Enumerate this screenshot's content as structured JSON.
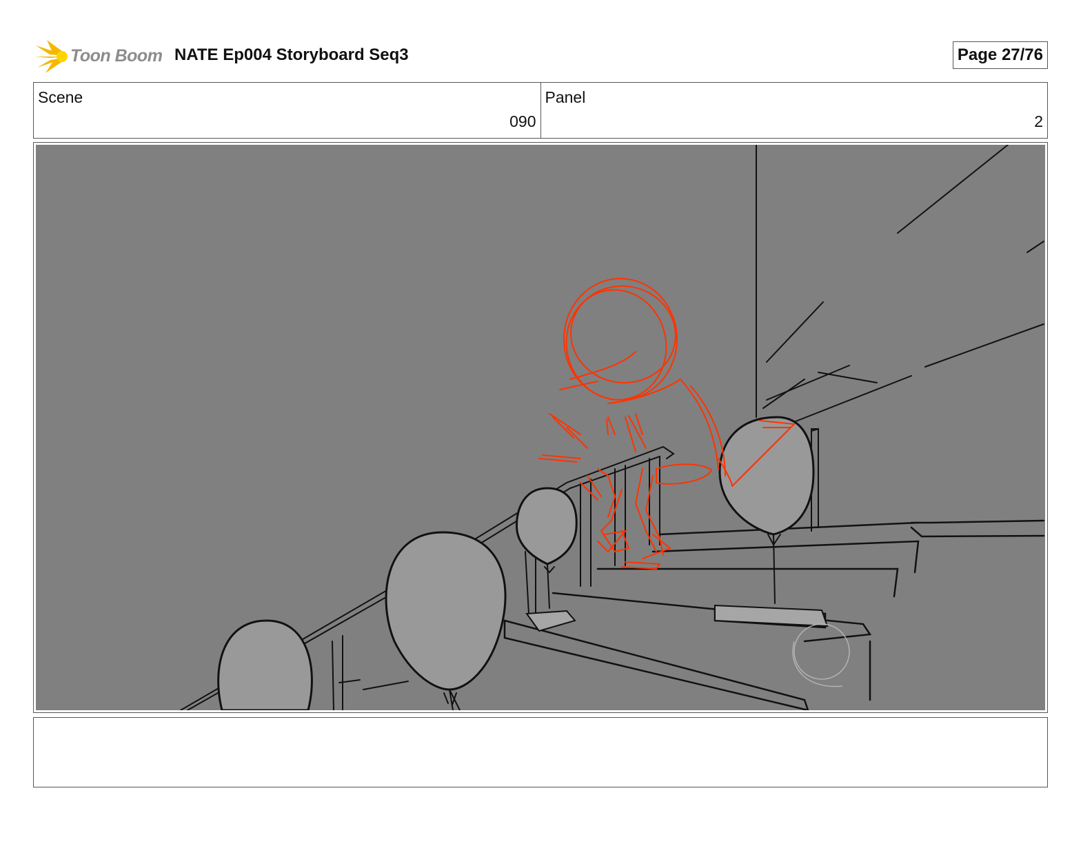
{
  "header": {
    "logo_text": "Toon Boom",
    "document_title": "NATE Ep004 Storyboard Seq3",
    "page_label": "Page 27/76"
  },
  "info": {
    "scene_label": "Scene",
    "scene_value": "090",
    "panel_label": "Panel",
    "panel_value": "2"
  },
  "panel": {
    "background_color": "#808080",
    "balloon_color": "#999999",
    "line_color": "#111111",
    "rough_sketch_color": "#ff3300"
  },
  "notes": {
    "text": ""
  }
}
